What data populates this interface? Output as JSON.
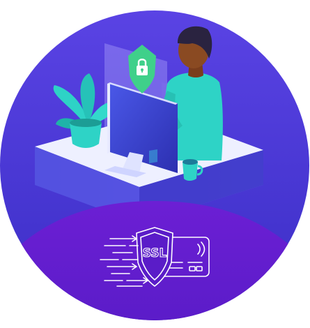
{
  "badge": {
    "ssl_text": "SSL",
    "icon": "ssl-shield-card-icon"
  },
  "illustration": {
    "padlock_icon": "padlock-shield-icon",
    "colors": {
      "circle_top": "#5b3fe0",
      "circle_bottom": "#3f2bc4",
      "bottom_band": "#6a1fd0",
      "desk_top": "#eef0ff",
      "desk_front": "#5a4fe0",
      "teal": "#2ed3c6",
      "shield_green": "#3fd08a",
      "skin": "#8a4a22",
      "hair": "#2a2340",
      "line_white": "#ffffff"
    }
  }
}
